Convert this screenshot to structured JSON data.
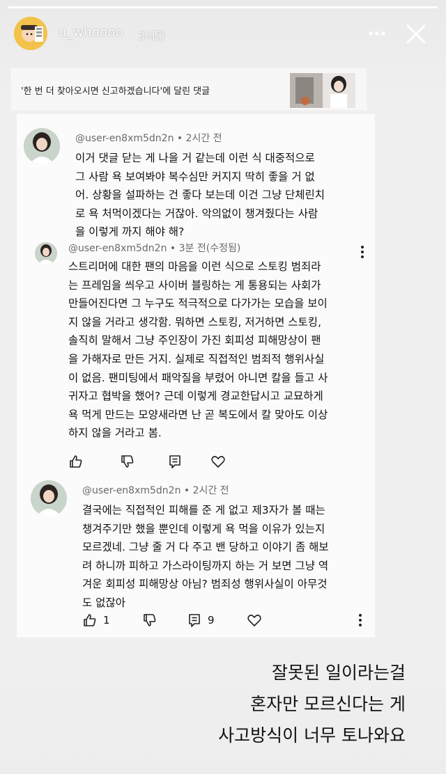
{
  "story": {
    "progress_fraction": 1.0,
    "username": "u_whoooo",
    "time_ago": "3시간",
    "more_icon": "more-horizontal-icon",
    "close_icon": "close-icon"
  },
  "shared_post": {
    "title": "'한 번 더 찾아오시면 신고하겠습니다'에 달린 댓글"
  },
  "comments": [
    {
      "author": "@user-en8xm5dn2n",
      "time": "2시간 전",
      "lines": [
        "이거 댓글 닫는 게 나을 거 같는데 이런 식 대중적으로",
        "그 사람 욕 보여봐야 복수심만 커지지 딱히 좋을 거 없",
        "어. 상황을 설파하는 건 좋다 보는데 이건 그냥 단체린치",
        "로 욕 처먹이겠다는 거잖아. 악의없이 챙겨줬다는 사람",
        "을 이렇게 까지 해야 해?"
      ]
    },
    {
      "author": "@user-en8xm5dn2n",
      "time": "3분 전(수정됨)",
      "lines": [
        "스트리머에 대한 팬의 마음을 이런 식으로 스토킹 범죄라",
        "는 프레임을 씌우고 사이버 블링하는 게 통용되는 사회가",
        "만들어진다면 그 누구도 적극적으로 다가가는 모습을 보이",
        "지 않을 거라고 생각함. 뭐하면 스토킹, 저거하면 스토킹,",
        "솔직히 말해서 그냥 주인장이 가진 회피성 피해망상이 팬",
        "을 가해자로 만든 거지. 실제로 직접적인 범죄적 행위사실",
        "이 없음. 팬미팅에서 패악질을 부렸어 아니면 칼을 들고 사",
        "귀자고 협박을 했어? 근데 이렇게 경교한답시고 교묘하게",
        "욕 먹게 만드는 모양새라면 난 곧 복도에서 칼 맞아도 이상",
        "하지 않을 거라고 봄."
      ]
    },
    {
      "author": "@user-en8xm5dn2n",
      "time": "2시간 전",
      "lines": [
        "결국에는 직접적인 피해를 준 게 없고 제3자가 볼 때는",
        "챙겨주기만 했을 뿐인데 이렇게 욕 먹을 이유가 있는지",
        "모르겠네. 그냥 줄 거 다 주고 밴 당하고 이야기 좀 해보",
        "려 하니까 피하고 가스라이팅까지 하는 거 보면 그냥 역",
        "겨운 회피성 피해망상 아님? 범죄성 행위사실이 아무것",
        "도 없잖아"
      ],
      "like_count": "1",
      "reply_count": "9"
    }
  ],
  "action_icons": [
    "thumbs-up-icon",
    "thumbs-down-icon",
    "reply-icon",
    "heart-icon",
    "kebab-menu-icon"
  ],
  "caption": {
    "lines": [
      "잘못된 일이라는걸",
      "혼자만 모르신다는 게",
      "사고방식이 너무 토나와요"
    ]
  }
}
